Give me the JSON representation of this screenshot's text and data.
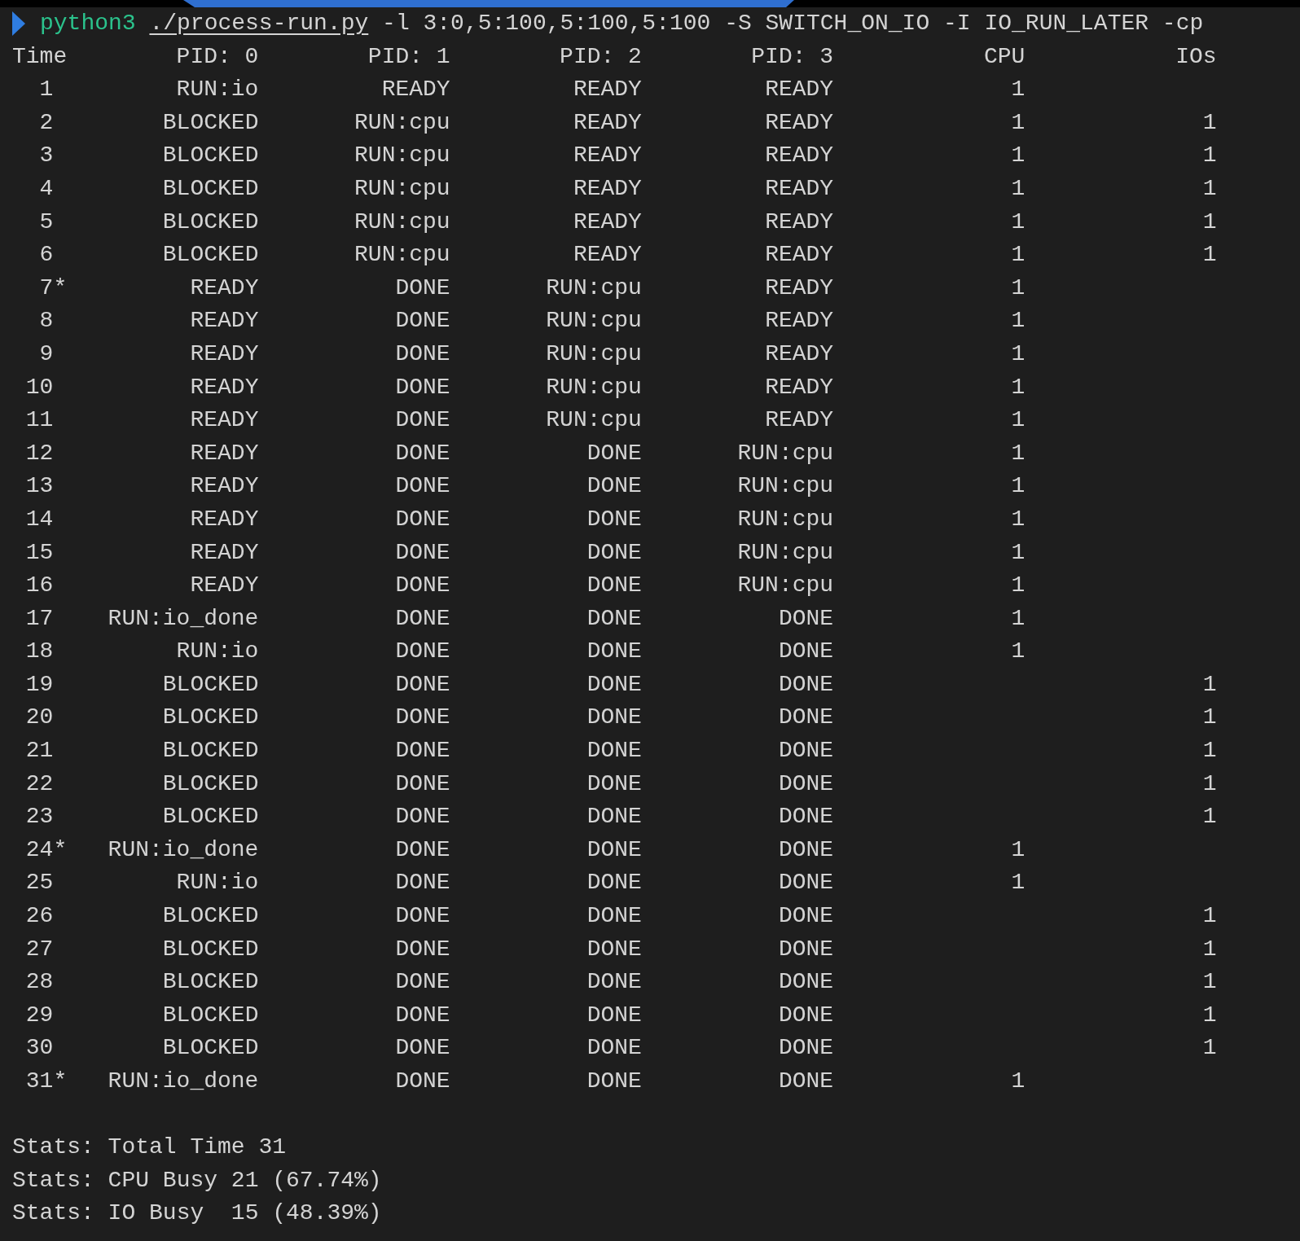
{
  "command": {
    "program": "python3",
    "script": "./process-run.py",
    "args": "-l 3:0,5:100,5:100,5:100 -S SWITCH_ON_IO -I IO_RUN_LATER -cp"
  },
  "columns": [
    "Time",
    "PID: 0",
    "PID: 1",
    "PID: 2",
    "PID: 3",
    "CPU",
    "IOs"
  ],
  "rows": [
    {
      "time": "1",
      "cells": [
        "RUN:io",
        "READY",
        "READY",
        "READY",
        "1",
        ""
      ]
    },
    {
      "time": "2",
      "cells": [
        "BLOCKED",
        "RUN:cpu",
        "READY",
        "READY",
        "1",
        "1"
      ]
    },
    {
      "time": "3",
      "cells": [
        "BLOCKED",
        "RUN:cpu",
        "READY",
        "READY",
        "1",
        "1"
      ]
    },
    {
      "time": "4",
      "cells": [
        "BLOCKED",
        "RUN:cpu",
        "READY",
        "READY",
        "1",
        "1"
      ]
    },
    {
      "time": "5",
      "cells": [
        "BLOCKED",
        "RUN:cpu",
        "READY",
        "READY",
        "1",
        "1"
      ]
    },
    {
      "time": "6",
      "cells": [
        "BLOCKED",
        "RUN:cpu",
        "READY",
        "READY",
        "1",
        "1"
      ]
    },
    {
      "time": "7",
      "flag": "*",
      "cells": [
        "READY",
        "DONE",
        "RUN:cpu",
        "READY",
        "1",
        ""
      ]
    },
    {
      "time": "8",
      "cells": [
        "READY",
        "DONE",
        "RUN:cpu",
        "READY",
        "1",
        ""
      ]
    },
    {
      "time": "9",
      "cells": [
        "READY",
        "DONE",
        "RUN:cpu",
        "READY",
        "1",
        ""
      ]
    },
    {
      "time": "10",
      "cells": [
        "READY",
        "DONE",
        "RUN:cpu",
        "READY",
        "1",
        ""
      ]
    },
    {
      "time": "11",
      "cells": [
        "READY",
        "DONE",
        "RUN:cpu",
        "READY",
        "1",
        ""
      ]
    },
    {
      "time": "12",
      "cells": [
        "READY",
        "DONE",
        "DONE",
        "RUN:cpu",
        "1",
        ""
      ]
    },
    {
      "time": "13",
      "cells": [
        "READY",
        "DONE",
        "DONE",
        "RUN:cpu",
        "1",
        ""
      ]
    },
    {
      "time": "14",
      "cells": [
        "READY",
        "DONE",
        "DONE",
        "RUN:cpu",
        "1",
        ""
      ]
    },
    {
      "time": "15",
      "cells": [
        "READY",
        "DONE",
        "DONE",
        "RUN:cpu",
        "1",
        ""
      ]
    },
    {
      "time": "16",
      "cells": [
        "READY",
        "DONE",
        "DONE",
        "RUN:cpu",
        "1",
        ""
      ]
    },
    {
      "time": "17",
      "cells": [
        "RUN:io_done",
        "DONE",
        "DONE",
        "DONE",
        "1",
        ""
      ]
    },
    {
      "time": "18",
      "cells": [
        "RUN:io",
        "DONE",
        "DONE",
        "DONE",
        "1",
        ""
      ]
    },
    {
      "time": "19",
      "cells": [
        "BLOCKED",
        "DONE",
        "DONE",
        "DONE",
        "",
        "1"
      ]
    },
    {
      "time": "20",
      "cells": [
        "BLOCKED",
        "DONE",
        "DONE",
        "DONE",
        "",
        "1"
      ]
    },
    {
      "time": "21",
      "cells": [
        "BLOCKED",
        "DONE",
        "DONE",
        "DONE",
        "",
        "1"
      ]
    },
    {
      "time": "22",
      "cells": [
        "BLOCKED",
        "DONE",
        "DONE",
        "DONE",
        "",
        "1"
      ]
    },
    {
      "time": "23",
      "cells": [
        "BLOCKED",
        "DONE",
        "DONE",
        "DONE",
        "",
        "1"
      ]
    },
    {
      "time": "24",
      "flag": "*",
      "cells": [
        "RUN:io_done",
        "DONE",
        "DONE",
        "DONE",
        "1",
        ""
      ]
    },
    {
      "time": "25",
      "cells": [
        "RUN:io",
        "DONE",
        "DONE",
        "DONE",
        "1",
        ""
      ]
    },
    {
      "time": "26",
      "cells": [
        "BLOCKED",
        "DONE",
        "DONE",
        "DONE",
        "",
        "1"
      ]
    },
    {
      "time": "27",
      "cells": [
        "BLOCKED",
        "DONE",
        "DONE",
        "DONE",
        "",
        "1"
      ]
    },
    {
      "time": "28",
      "cells": [
        "BLOCKED",
        "DONE",
        "DONE",
        "DONE",
        "",
        "1"
      ]
    },
    {
      "time": "29",
      "cells": [
        "BLOCKED",
        "DONE",
        "DONE",
        "DONE",
        "",
        "1"
      ]
    },
    {
      "time": "30",
      "cells": [
        "BLOCKED",
        "DONE",
        "DONE",
        "DONE",
        "",
        "1"
      ]
    },
    {
      "time": "31",
      "flag": "*",
      "cells": [
        "RUN:io_done",
        "DONE",
        "DONE",
        "DONE",
        "1",
        ""
      ]
    }
  ],
  "stats": [
    "Stats: Total Time 31",
    "Stats: CPU Busy 21 (67.74%)",
    "Stats: IO Busy  15 (48.39%)"
  ]
}
